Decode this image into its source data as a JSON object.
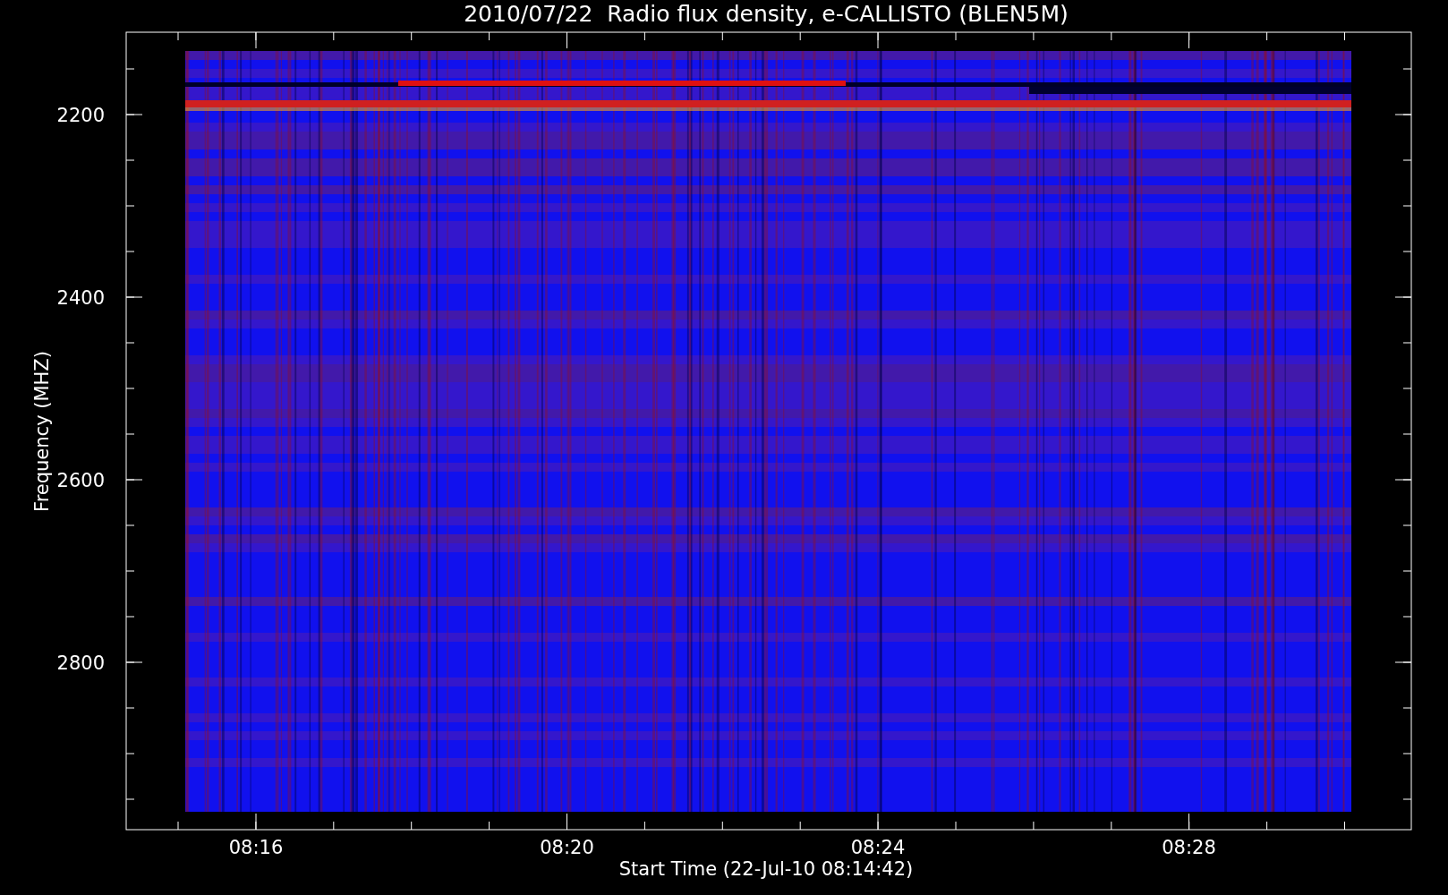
{
  "plot": {
    "title": "2010/07/22  Radio flux density, e-CALLISTO (BLEN5M)",
    "xlabel": "Start Time (22-Jul-10 08:14:42)",
    "ylabel": "Frequency (MHZ)",
    "xticks": [
      "08:16",
      "08:20",
      "08:24",
      "08:28"
    ],
    "yticks": [
      "2200",
      "2400",
      "2600",
      "2800"
    ],
    "kind": "spectrogram"
  }
}
